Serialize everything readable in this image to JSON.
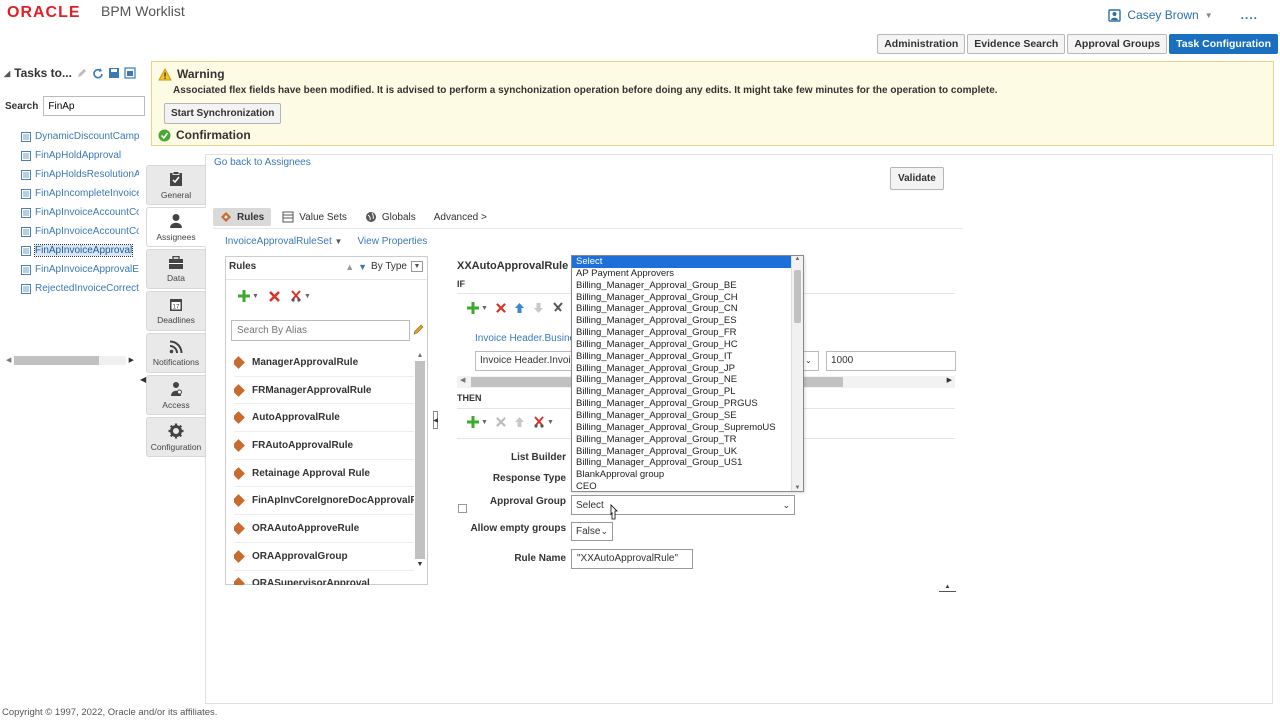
{
  "header": {
    "logo": "ORACLE",
    "title": "BPM Worklist",
    "user": "Casey Brown",
    "more": "...."
  },
  "global_tabs": [
    {
      "label": "Administration",
      "active": false
    },
    {
      "label": "Evidence Search",
      "active": false
    },
    {
      "label": "Approval Groups",
      "active": false
    },
    {
      "label": "Task Configuration",
      "active": true
    }
  ],
  "left_panel": {
    "title": "Tasks to...",
    "search_label": "Search",
    "search_value": "FinAp",
    "tasks": [
      "DynamicDiscountCampaig",
      "FinApHoldApproval",
      "FinApHoldsResolutionApp",
      "FinApIncompleteInvoiceHo",
      "FinApInvoiceAccountCodir",
      "FinApInvoiceAccountCodir",
      "FinApInvoiceApproval",
      "FinApInvoiceApprovalErro",
      "RejectedInvoiceCorrection"
    ],
    "selected_index": 6
  },
  "warning": {
    "title": "Warning",
    "message": "Associated flex fields have been modified. It is advised to perform a synchonization operation before doing any edits. It might take few minutes for the operation to complete.",
    "sync_button": "Start Synchronization",
    "confirmation": "Confirmation"
  },
  "vnav": [
    {
      "label": "General",
      "icon": "clipboard-check-icon"
    },
    {
      "label": "Assignees",
      "icon": "person-icon",
      "active": true
    },
    {
      "label": "Data",
      "icon": "briefcase-icon"
    },
    {
      "label": "Deadlines",
      "icon": "calendar-icon"
    },
    {
      "label": "Notifications",
      "icon": "rss-icon"
    },
    {
      "label": "Access",
      "icon": "person-key-icon"
    },
    {
      "label": "Configuration",
      "icon": "gear-icon"
    }
  ],
  "main": {
    "go_back": "Go back to Assignees",
    "validate": "Validate",
    "sub_tabs": [
      "Rules",
      "Value Sets",
      "Globals",
      "Advanced >"
    ],
    "ruleset": "InvoiceApprovalRuleSet",
    "view_properties": "View Properties"
  },
  "rules_panel": {
    "title": "Rules",
    "sort_label": "By Type",
    "search_placeholder": "Search By Alias",
    "rules": [
      "ManagerApprovalRule",
      "FRManagerApprovalRule",
      "AutoApprovalRule",
      "FRAutoApprovalRule",
      "Retainage Approval Rule",
      "FinApInvCoreIgnoreDocApprovalRul",
      "ORAAutoApproveRule",
      "ORAApprovalGroup",
      "ORASupervisorApproval"
    ]
  },
  "rule_detail": {
    "name": "XXAutoApprovalRule",
    "if_label": "IF",
    "then_label": "THEN",
    "condition_link": "Invoice Header.Business",
    "condition_field": "Invoice Header.Invoice",
    "condition_value": "1000",
    "list_builder_label": "List Builder",
    "response_type_label": "Response Type",
    "approval_group_label": "Approval Group",
    "approval_group_value": "Select",
    "allow_empty_label": "Allow empty groups",
    "allow_empty_value": "False",
    "rule_name_label": "Rule Name",
    "rule_name_value": "\"XXAutoApprovalRule\""
  },
  "dropdown_options": [
    "Select",
    "AP Payment Approvers",
    "Billing_Manager_Approval_Group_BE",
    "Billing_Manager_Approval_Group_CH",
    "Billing_Manager_Approval_Group_CN",
    "Billing_Manager_Approval_Group_ES",
    "Billing_Manager_Approval_Group_FR",
    "Billing_Manager_Approval_Group_HC",
    "Billing_Manager_Approval_Group_IT",
    "Billing_Manager_Approval_Group_JP",
    "Billing_Manager_Approval_Group_NE",
    "Billing_Manager_Approval_Group_PL",
    "Billing_Manager_Approval_Group_PRGUS",
    "Billing_Manager_Approval_Group_SE",
    "Billing_Manager_Approval_Group_SupremoUS",
    "Billing_Manager_Approval_Group_TR",
    "Billing_Manager_Approval_Group_UK",
    "Billing_Manager_Approval_Group_US1",
    "BlankApproval group",
    "CEO"
  ],
  "footer": "Copyright © 1997, 2022, Oracle and/or its affiliates.",
  "colors": {
    "accent": "#1a6fbe",
    "oracle_red": "#e01f26",
    "link": "#3b79b5",
    "selected_option": "#1e6fd9"
  }
}
